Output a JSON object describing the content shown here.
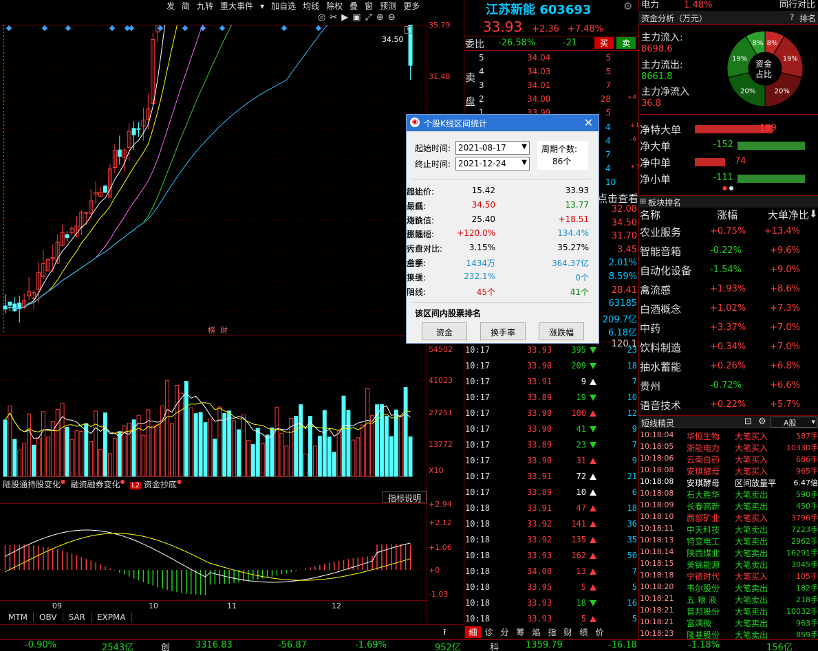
{
  "toolbar": {
    "items": [
      "发",
      "简",
      "九转",
      "重大事件",
      "加自选",
      "均线",
      "除权",
      "叠",
      "窗",
      "预测",
      "更多"
    ]
  },
  "stock": {
    "name": "江苏新能",
    "code": "603693",
    "price": "33.93",
    "change": "+2.36",
    "change_pct": "+7.48%"
  },
  "top_right": {
    "sector": "电力",
    "sector_pct": "1.48%",
    "peer": "同行对比"
  },
  "weibi": {
    "label": "委比",
    "pct": "-26.58%",
    "diff": "-21",
    "buy": "买",
    "sell": "卖"
  },
  "order_book": {
    "sell_label": [
      "卖",
      "盘"
    ],
    "sells": [
      {
        "lvl": "5",
        "price": "34.04",
        "vol": "5",
        "chg": ""
      },
      {
        "lvl": "4",
        "price": "34.03",
        "vol": "5",
        "chg": ""
      },
      {
        "lvl": "3",
        "price": "34.01",
        "vol": "7",
        "chg": ""
      },
      {
        "lvl": "2",
        "price": "34.00",
        "vol": "28",
        "chg": "+4"
      },
      {
        "lvl": "1",
        "price": "33.99",
        "vol": "5",
        "chg": ""
      }
    ],
    "partial_vols": [
      {
        "vol": "4",
        "chg": "+1"
      },
      {
        "vol": "4",
        "chg": "-6"
      },
      {
        "vol": "7",
        "chg": ""
      },
      {
        "vol": "4",
        "chg": "+3"
      },
      {
        "vol": "10",
        "chg": ""
      }
    ],
    "click_view": "点击查看",
    "stats": [
      "32.08",
      "34.50",
      "31.70",
      "3.45",
      "2.01%",
      "8.59%",
      "28.41",
      "63185",
      "209.7亿",
      "6.18亿",
      "120.1"
    ]
  },
  "chart": {
    "price_axis": [
      "35.79",
      "31.48"
    ],
    "hi_label": "34.50",
    "month_labels": [
      "09",
      "10",
      "11",
      "12"
    ],
    "vol_axis": [
      "54502",
      "41023",
      "27251",
      "13772"
    ],
    "vol_unit": "X10",
    "macd_axis": [
      "+2.94",
      "+2.12",
      "+1.06",
      "+0",
      "-1.03"
    ],
    "tags": [
      "榜",
      "财"
    ],
    "sub_tabs": [
      "陆股通持股变化",
      "融资融券变化",
      "L2",
      "资金抄底"
    ],
    "indicator_btn": "指标说明",
    "bottom_tabs": [
      "MTM",
      "OBV",
      "SAR",
      "EXPMA"
    ]
  },
  "trades": [
    {
      "t": "10:17",
      "p": "33.93",
      "v": "395",
      "d": "down",
      "n": "23"
    },
    {
      "t": "10:17",
      "p": "33.90",
      "v": "209",
      "d": "down",
      "n": "18"
    },
    {
      "t": "10:17",
      "p": "33.91",
      "v": "9",
      "d": "white",
      "n": "7"
    },
    {
      "t": "10:17",
      "p": "33.89",
      "v": "19",
      "d": "down",
      "n": "10"
    },
    {
      "t": "10:17",
      "p": "33.90",
      "v": "100",
      "d": "up",
      "n": "12"
    },
    {
      "t": "10:17",
      "p": "33.90",
      "v": "41",
      "d": "down",
      "n": "9"
    },
    {
      "t": "10:17",
      "p": "33.89",
      "v": "23",
      "d": "down",
      "n": "7"
    },
    {
      "t": "10:17",
      "p": "33.90",
      "v": "31",
      "d": "up",
      "n": "9"
    },
    {
      "t": "10:17",
      "p": "33.91",
      "v": "72",
      "d": "white",
      "n": "21"
    },
    {
      "t": "10:17",
      "p": "33.89",
      "v": "10",
      "d": "white",
      "n": "6"
    },
    {
      "t": "10:18",
      "p": "33.91",
      "v": "47",
      "d": "up",
      "n": "18"
    },
    {
      "t": "10:18",
      "p": "33.92",
      "v": "141",
      "d": "up",
      "n": "36"
    },
    {
      "t": "10:18",
      "p": "33.92",
      "v": "135",
      "d": "up",
      "n": "35"
    },
    {
      "t": "10:18",
      "p": "33.93",
      "v": "162",
      "d": "up",
      "n": "50"
    },
    {
      "t": "10:18",
      "p": "34.00",
      "v": "13",
      "d": "up",
      "n": "7"
    },
    {
      "t": "10:18",
      "p": "33.95",
      "v": "5",
      "d": "up",
      "n": "5"
    },
    {
      "t": "10:18",
      "p": "33.93",
      "v": "18",
      "d": "down",
      "n": "16"
    },
    {
      "t": "10:18",
      "p": "33.93",
      "v": "5",
      "d": "up",
      "n": "5"
    }
  ],
  "right_tabs": [
    "细",
    "诊",
    "分",
    "筹",
    "焰",
    "指",
    "财",
    "绩",
    "价"
  ],
  "fund": {
    "title": "资金分析（万元）",
    "help": "?",
    "rank": "排名",
    "inflow_label": "主力流入:",
    "inflow": "8698.6",
    "outflow_label": "主力流出:",
    "outflow": "8661.8",
    "net_label": "主力净流入",
    "net": "36.8",
    "pie_center": [
      "资金",
      "占比"
    ],
    "pie_labels": [
      "8%",
      "8%",
      "19%",
      "19%",
      "20%",
      "20%"
    ],
    "bars": [
      {
        "label": "净特大单",
        "value": "189"
      },
      {
        "label": "净大单",
        "value": "-152"
      },
      {
        "label": "净中单",
        "value": "74"
      },
      {
        "label": "净小单",
        "value": "-111"
      }
    ]
  },
  "sector_rank": {
    "title": "板块排名",
    "headers": [
      "名称",
      "涨幅",
      "大单净比"
    ],
    "rows": [
      {
        "name": "农业服务",
        "chg": "+0.75%",
        "net": "+13.4%"
      },
      {
        "name": "智能音箱",
        "chg": "-0.22%",
        "net": "+9.6%"
      },
      {
        "name": "自动化设备",
        "chg": "-1.54%",
        "net": "+9.0%"
      },
      {
        "name": "禽流感",
        "chg": "+1.93%",
        "net": "+8.6%"
      },
      {
        "name": "白酒概念",
        "chg": "+1.02%",
        "net": "+7.3%"
      },
      {
        "name": "中药",
        "chg": "+3.37%",
        "net": "+7.0%"
      },
      {
        "name": "饮料制造",
        "chg": "+0.34%",
        "net": "+7.0%"
      },
      {
        "name": "抽水蓄能",
        "chg": "+0.26%",
        "net": "+6.8%"
      },
      {
        "name": "贵州",
        "chg": "-0.72%",
        "net": "+6.6%"
      },
      {
        "name": "语音技术",
        "chg": "+0.22%",
        "net": "+5.7%"
      }
    ]
  },
  "elf": {
    "title": "短线精灵",
    "market": "A股",
    "rows": [
      {
        "t": "10:18:04",
        "n": "华恒生物",
        "a": "大笔买入",
        "v": "587手",
        "c": "red"
      },
      {
        "t": "10:18:05",
        "n": "浙能电力",
        "a": "大笔买入",
        "v": "10330手",
        "c": "red"
      },
      {
        "t": "10:18:06",
        "n": "云南白药",
        "a": "大笔买入",
        "v": "686手",
        "c": "red"
      },
      {
        "t": "10:18:08",
        "n": "安琪酵母",
        "a": "大笔买入",
        "v": "965手",
        "c": "red"
      },
      {
        "t": "10:18:08",
        "n": "安琪酵母",
        "a": "区间放量平",
        "v": "6.47倍",
        "c": "yellow"
      },
      {
        "t": "10:18:08",
        "n": "石大胜华",
        "a": "大笔卖出",
        "v": "590手",
        "c": "green"
      },
      {
        "t": "10:18:09",
        "n": "长春高新",
        "a": "大笔卖出",
        "v": "450手",
        "c": "green"
      },
      {
        "t": "10:18:10",
        "n": "西部矿业",
        "a": "大笔买入",
        "v": "3796手",
        "c": "red"
      },
      {
        "t": "10:18:11",
        "n": "中天科技",
        "a": "大笔卖出",
        "v": "7223手",
        "c": "green"
      },
      {
        "t": "10:18:13",
        "n": "特变电工",
        "a": "大笔卖出",
        "v": "2962手",
        "c": "green"
      },
      {
        "t": "10:18:14",
        "n": "陕西煤业",
        "a": "大笔卖出",
        "v": "16291手",
        "c": "green"
      },
      {
        "t": "10:18:15",
        "n": "美锦能源",
        "a": "大笔卖出",
        "v": "3045手",
        "c": "green"
      },
      {
        "t": "10:18:18",
        "n": "宁德时代",
        "a": "大笔买入",
        "v": "105手",
        "c": "red"
      },
      {
        "t": "10:18:20",
        "n": "韦尔股份",
        "a": "大笔卖出",
        "v": "182手",
        "c": "green"
      },
      {
        "t": "10:18:21",
        "n": "五 粮 液",
        "a": "大笔卖出",
        "v": "218手",
        "c": "green"
      },
      {
        "t": "10:18:21",
        "n": "普邦股份",
        "a": "大笔卖出",
        "v": "10032手",
        "c": "green"
      },
      {
        "t": "10:18:21",
        "n": "富满微",
        "a": "大笔卖出",
        "v": "963手",
        "c": "green"
      },
      {
        "t": "10:18:23",
        "n": "隆基股份",
        "a": "大笔卖出",
        "v": "859手",
        "c": "green"
      }
    ]
  },
  "status_bar": {
    "a": "-0.90%",
    "b": "2543亿",
    "c": "创",
    "d": "3316.83",
    "e": "-56.87",
    "f": "-1.69%",
    "g": "952亿",
    "h": "科",
    "i": "1359.79",
    "j": "-16.18",
    "k": "-1.18%",
    "l": "156亿"
  },
  "dialog": {
    "title": "个股K线区间统计",
    "start_label": "起始时间:",
    "start": "2021-08-17",
    "end_label": "终止时间:",
    "end": "2021-12-24",
    "period_label": "周期个数:",
    "period": "86个",
    "stats": [
      {
        "l": "起始价:",
        "v": "15.42",
        "c": "#000"
      },
      {
        "l": "终止价:",
        "v": "33.93",
        "c": "#000"
      },
      {
        "l": "最高:",
        "v": "34.50",
        "c": "#e00000"
      },
      {
        "l": "最低:",
        "v": "13.77",
        "c": "#008000"
      },
      {
        "l": "均价:",
        "v": "25.40",
        "c": "#000"
      },
      {
        "l": "涨跌值:",
        "v": "+18.51",
        "c": "#e00000"
      },
      {
        "l": "涨跌幅:",
        "v": "+120.0%",
        "c": "#e00000"
      },
      {
        "l": "振幅:",
        "v": "134.4%",
        "c": "#1a8fc9"
      },
      {
        "l": "大盘对比:",
        "v": "3.15%",
        "c": "#000"
      },
      {
        "l": "行业对比:",
        "v": "35.27%",
        "c": "#000"
      },
      {
        "l": "总手:",
        "v": "1434万",
        "c": "#1a8fc9"
      },
      {
        "l": "金额:",
        "v": "364.37亿",
        "c": "#1a8fc9"
      },
      {
        "l": "换手:",
        "v": "232.1%",
        "c": "#1a8fc9"
      },
      {
        "l": "平线:",
        "v": "0个",
        "c": "#1a8fc9"
      },
      {
        "l": "阳线:",
        "v": "45个",
        "c": "#e00000"
      },
      {
        "l": "阴线:",
        "v": "41个",
        "c": "#008000"
      }
    ],
    "rank_title": "该区间内股票排名",
    "buttons": [
      "资金",
      "换手率",
      "涨跌幅"
    ]
  }
}
